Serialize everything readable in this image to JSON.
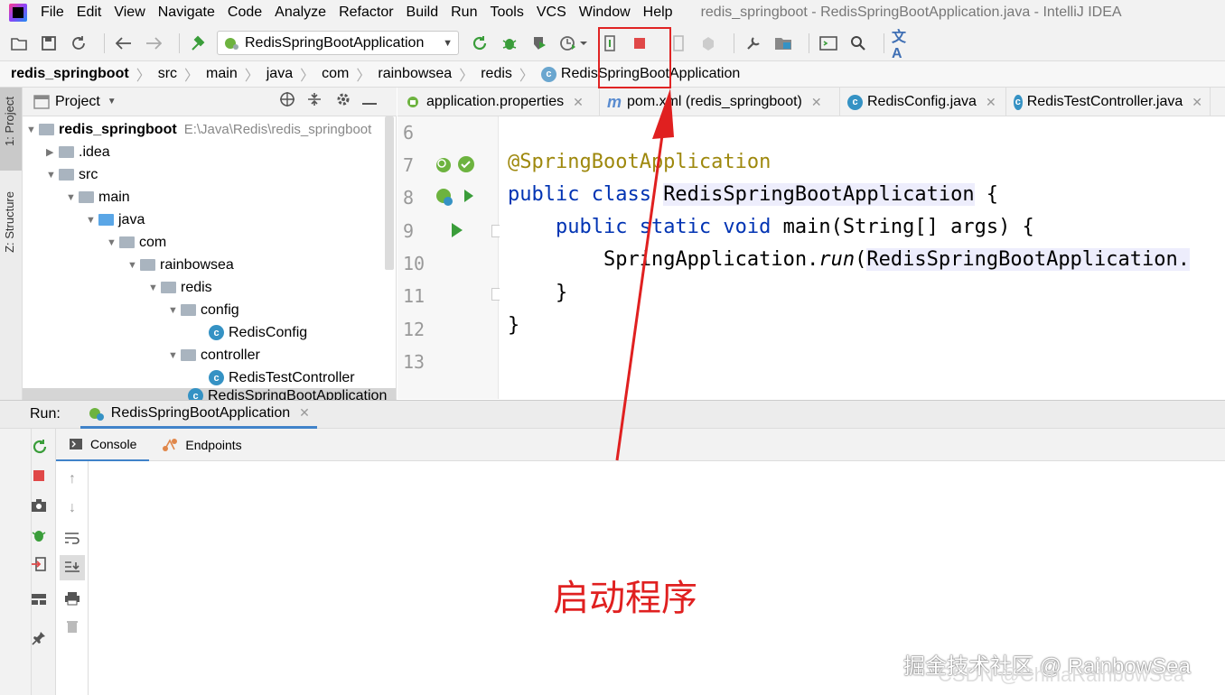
{
  "menubar": {
    "items": [
      "File",
      "Edit",
      "View",
      "Navigate",
      "Code",
      "Analyze",
      "Refactor",
      "Build",
      "Run",
      "Tools",
      "VCS",
      "Window",
      "Help"
    ],
    "window_title": "redis_springboot - RedisSpringBootApplication.java - IntelliJ IDEA"
  },
  "toolbar": {
    "run_config": "RedisSpringBootApplication",
    "icons": [
      "open-icon",
      "save-icon",
      "sync-icon",
      "back-icon",
      "forward-icon",
      "build-icon",
      "rerun-icon",
      "debug-icon",
      "coverage-icon",
      "profile-icon",
      "attach-icon",
      "stop-icon",
      "device-icon",
      "gradle-icon",
      "settings-icon",
      "project-structure-icon",
      "terminal-icon",
      "search-icon",
      "translate-icon"
    ]
  },
  "breadcrumb": [
    "redis_springboot",
    "src",
    "main",
    "java",
    "com",
    "rainbowsea",
    "redis",
    "RedisSpringBootApplication"
  ],
  "tool_windows": {
    "project_tab": "1: Project",
    "structure_tab": "Z: Structure"
  },
  "project": {
    "header": "Project",
    "tree": [
      {
        "label": "redis_springboot",
        "path": "E:\\Java\\Redis\\redis_springboot",
        "depth": 0,
        "kind": "module",
        "expanded": true
      },
      {
        "label": ".idea",
        "depth": 1,
        "kind": "folder",
        "expanded": false
      },
      {
        "label": "src",
        "depth": 1,
        "kind": "folder",
        "expanded": true
      },
      {
        "label": "main",
        "depth": 2,
        "kind": "folder",
        "expanded": true
      },
      {
        "label": "java",
        "depth": 3,
        "kind": "source-folder",
        "expanded": true
      },
      {
        "label": "com",
        "depth": 4,
        "kind": "package",
        "expanded": true
      },
      {
        "label": "rainbowsea",
        "depth": 5,
        "kind": "package",
        "expanded": true
      },
      {
        "label": "redis",
        "depth": 6,
        "kind": "package",
        "expanded": true
      },
      {
        "label": "config",
        "depth": 7,
        "kind": "package",
        "expanded": true
      },
      {
        "label": "RedisConfig",
        "depth": 8,
        "kind": "class"
      },
      {
        "label": "controller",
        "depth": 7,
        "kind": "package",
        "expanded": true
      },
      {
        "label": "RedisTestController",
        "depth": 8,
        "kind": "class"
      },
      {
        "label": "RedisSpringBootApplication",
        "depth": 7,
        "kind": "class"
      }
    ]
  },
  "editor": {
    "tabs": [
      {
        "label": "application.properties",
        "icon": "properties-icon"
      },
      {
        "label": "pom.xml (redis_springboot)",
        "icon": "maven-icon"
      },
      {
        "label": "RedisConfig.java",
        "icon": "class-icon"
      },
      {
        "label": "RedisTestController.java",
        "icon": "class-icon"
      }
    ],
    "line_numbers": [
      "6",
      "7",
      "8",
      "9",
      "10",
      "11",
      "12",
      "13"
    ],
    "lines": {
      "l7_annotation": "@SpringBootApplication",
      "l8_kw": "public class ",
      "l8_name": "RedisSpringBootApplication",
      "l8_tail": " {",
      "l9_kw": "public static void ",
      "l9_rest": "main(String[] args) {",
      "l10_obj": "SpringApplication.",
      "l10_method": "run",
      "l10_paren": "(",
      "l10_arg": "RedisSpringBootApplication.",
      "l11": "}",
      "l12": "}"
    }
  },
  "run_panel": {
    "label": "Run:",
    "tab": "RedisSpringBootApplication",
    "subtabs": [
      "Console",
      "Endpoints"
    ]
  },
  "annotation": {
    "text": "启动程序",
    "color": "#e02020"
  },
  "watermark": {
    "line1": "掘金技术社区 @ RainbowSea",
    "line2": "CSDN @ChinaRainbowSea"
  }
}
